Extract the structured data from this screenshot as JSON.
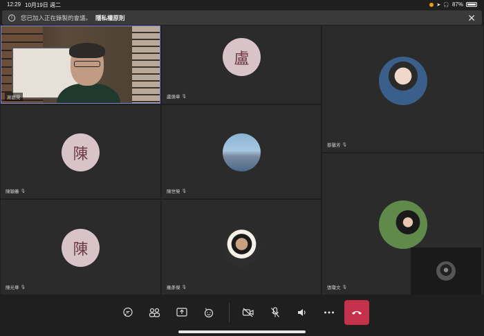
{
  "status_bar": {
    "time": "12:29",
    "date": "10月19日 週二",
    "battery": "87%",
    "battery_level": 0.87
  },
  "banner": {
    "message": "您已加入正在錄製的會議。",
    "link": "隱私權原則"
  },
  "participants": [
    {
      "name": "謝庭晃",
      "type": "video"
    },
    {
      "name": "盧煥章",
      "type": "initial",
      "initial": "盧"
    },
    {
      "name": "蔡馨芳",
      "type": "photo"
    },
    {
      "name": "陳穎蓁",
      "type": "initial",
      "initial": "陳"
    },
    {
      "name": "陳世榮",
      "type": "photo"
    },
    {
      "name": "陳光華",
      "type": "initial",
      "initial": "陳"
    },
    {
      "name": "羅彥傑",
      "type": "photo"
    },
    {
      "name": "張瓊文",
      "type": "photo"
    }
  ],
  "toolbar": {
    "items": [
      "chat-icon",
      "people-icon",
      "share-icon",
      "reaction-icon",
      "camera-off-icon",
      "mic-off-icon",
      "speaker-icon",
      "more-icon",
      "hang-up-icon"
    ]
  },
  "colors": {
    "accent": "#7b84d6",
    "hangup": "#c4314b",
    "avatar_bg": "#d8c3c9",
    "avatar_fg": "#6d3a4a"
  }
}
